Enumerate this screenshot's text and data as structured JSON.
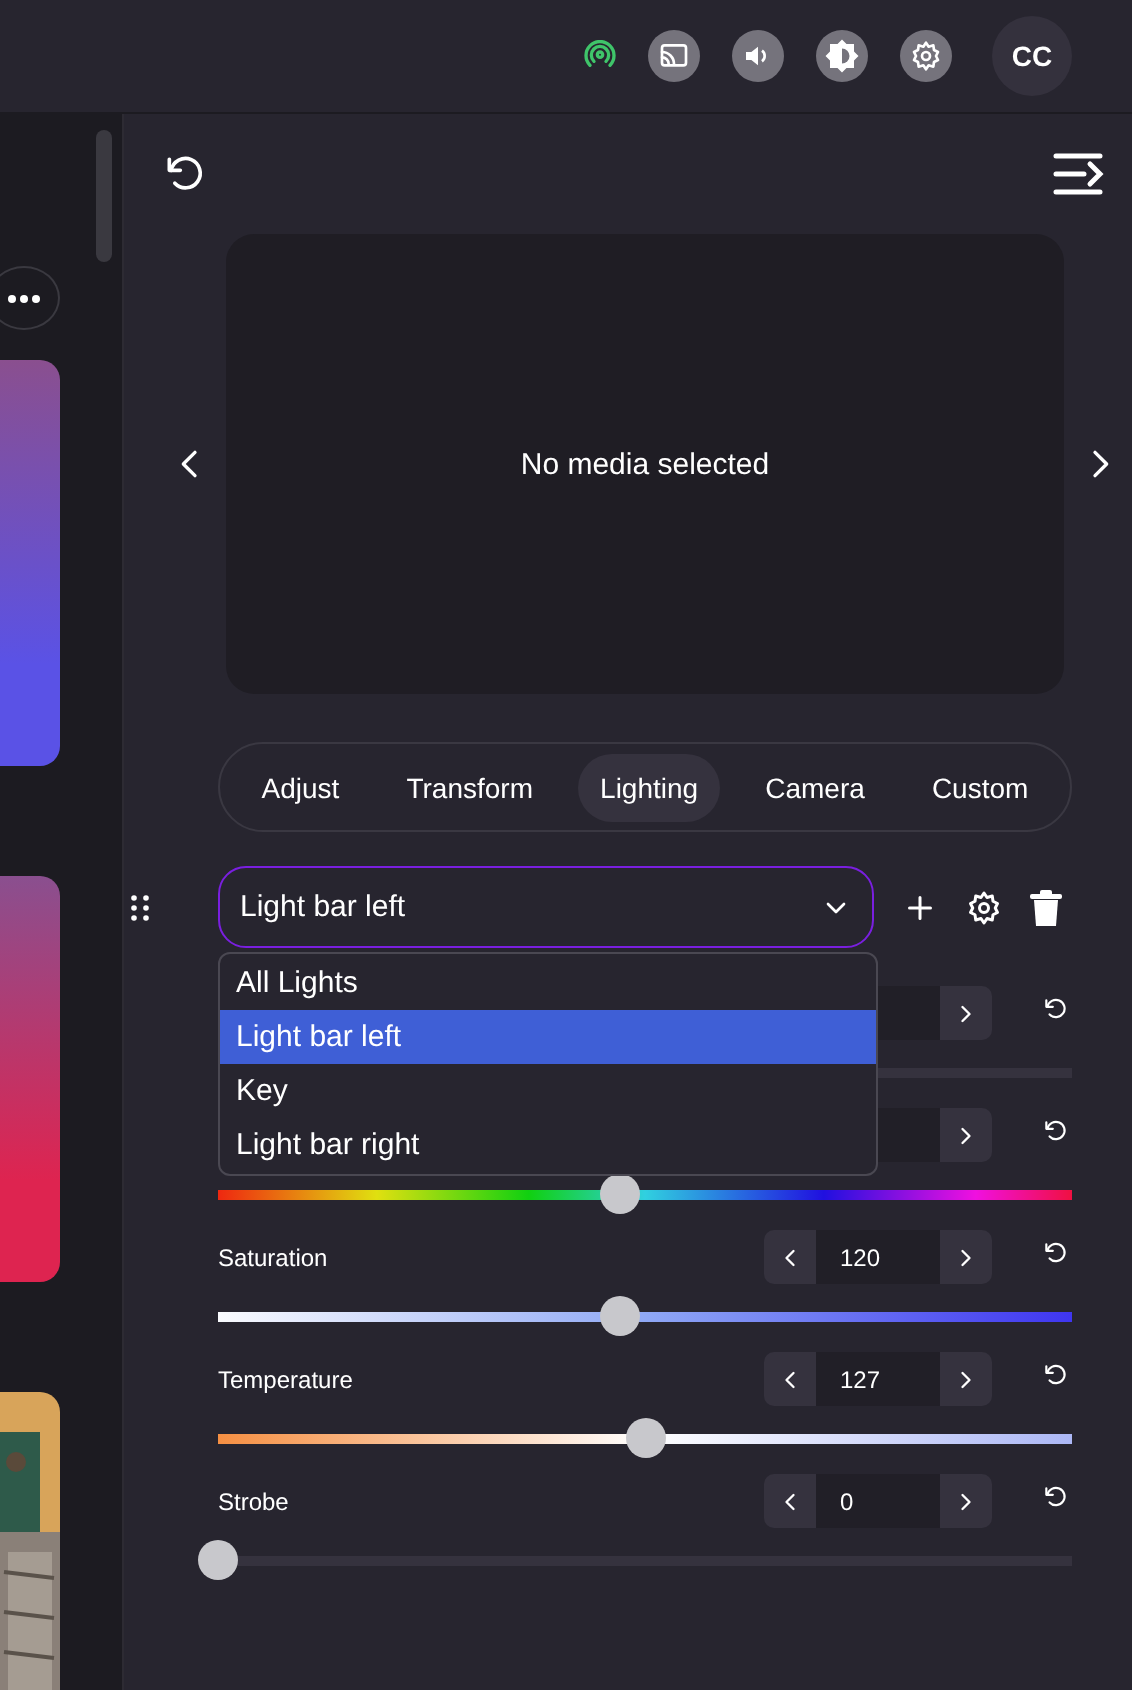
{
  "top_bar": {
    "avatar": "CC",
    "connection_active": true
  },
  "left_strip": {
    "cards": [
      {
        "kind": "gradient",
        "color": "#5a52e6"
      },
      {
        "kind": "gradient",
        "color": "#de2450"
      },
      {
        "kind": "picture"
      }
    ]
  },
  "preview": {
    "message": "No media selected"
  },
  "tabs": [
    {
      "label": "Adjust",
      "selected": false
    },
    {
      "label": "Transform",
      "selected": false
    },
    {
      "label": "Lighting",
      "selected": true
    },
    {
      "label": "Camera",
      "selected": false
    },
    {
      "label": "Custom",
      "selected": false
    }
  ],
  "light_select": {
    "value": "Light bar left",
    "expanded": true,
    "options": [
      {
        "label": "All Lights",
        "selected": false
      },
      {
        "label": "Light bar left",
        "selected": true
      },
      {
        "label": "Key",
        "selected": false
      },
      {
        "label": "Light bar right",
        "selected": false
      }
    ]
  },
  "controls": [
    {
      "kind": "plain"
    },
    {
      "kind": "hue",
      "level": 0.47
    },
    {
      "label": "Saturation",
      "value": "120",
      "kind": "saturation",
      "level": 0.47
    },
    {
      "label": "Temperature",
      "value": "127",
      "kind": "temperature",
      "level": 0.5
    },
    {
      "label": "Strobe",
      "value": "0",
      "kind": "plain",
      "level": 0
    }
  ]
}
